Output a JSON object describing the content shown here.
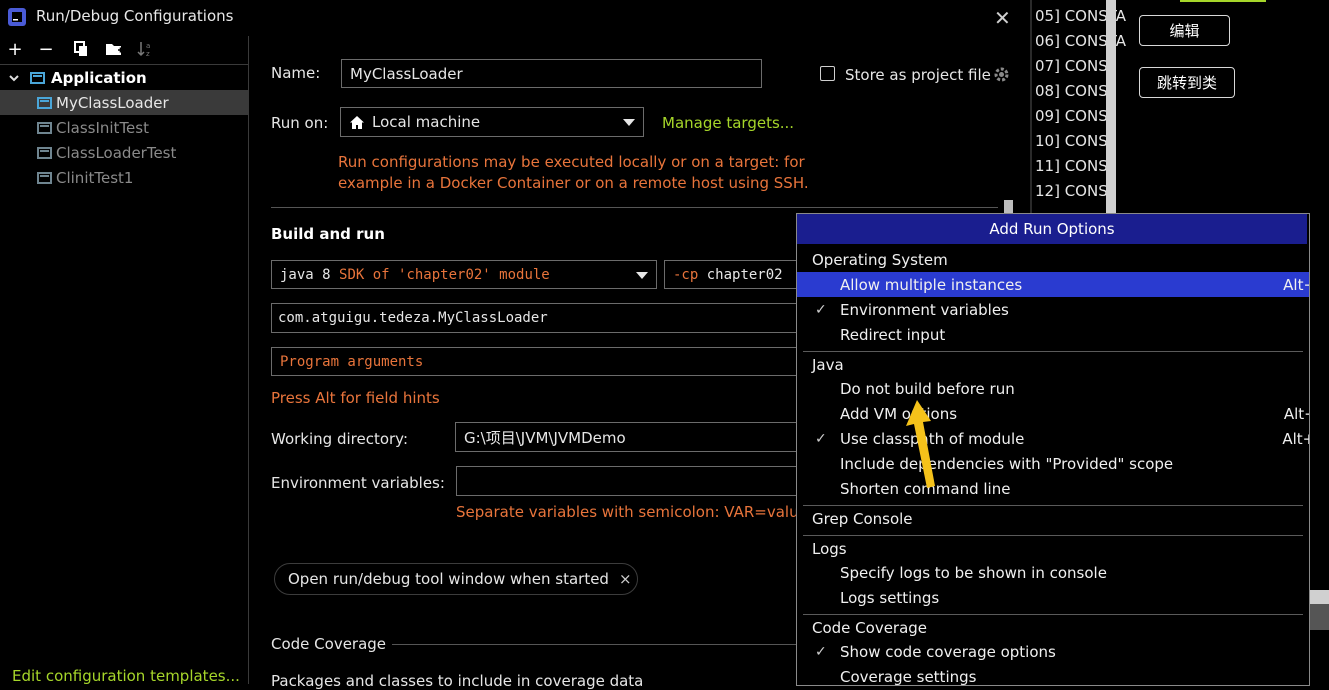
{
  "window": {
    "title": "Run/Debug Configurations",
    "close_icon": "close-icon"
  },
  "toolbar": {
    "add": "+",
    "remove": "−",
    "copy": "copy-icon",
    "new_folder": "new-folder-icon",
    "sort": "sort-icon"
  },
  "tree": {
    "root": "Application",
    "items": [
      {
        "label": "MyClassLoader",
        "selected": true
      },
      {
        "label": "ClassInitTest",
        "selected": false
      },
      {
        "label": "ClassLoaderTest",
        "selected": false
      },
      {
        "label": "ClinitTest1",
        "selected": false
      }
    ],
    "edit_templates": "Edit configuration templates..."
  },
  "form": {
    "name_label": "Name:",
    "name_value": "MyClassLoader",
    "store_label": "Store as project file",
    "run_on_label": "Run on:",
    "run_on_value": "Local machine",
    "manage_targets": "Manage targets...",
    "run_on_hint_1": "Run configurations may be executed locally or on a target: for",
    "run_on_hint_2": "example in a Docker Container or on a remote host using SSH.",
    "build_and_run": "Build and run",
    "sdk_prefix": "java 8",
    "sdk_suffix": "SDK of 'chapter02' module",
    "cp_flag": "-cp",
    "cp_value": "chapter02",
    "main_class": "com.atguigu.tedeza.MyClassLoader",
    "program_args_placeholder": "Program arguments",
    "alt_hint": "Press Alt for field hints",
    "working_dir_label": "Working directory:",
    "working_dir_value": "G:\\项目\\JVM\\JVMDemo",
    "env_label": "Environment variables:",
    "env_value": "",
    "env_hint": "Separate variables with semicolon: VAR=value;",
    "chip_label": "Open run/debug tool window when started",
    "chip_close": "×",
    "code_coverage": "Code Coverage",
    "packages_label": "Packages and classes to include in coverage data"
  },
  "right_strip": {
    "lines": [
      "05] CONSTA",
      "06] CONSTA",
      "07] CONS",
      "08] CONS",
      "09] CONS",
      "10] CONS",
      "11] CONS",
      "12] CONS"
    ],
    "edit_button": "编辑",
    "jump_button": "跳转到类"
  },
  "popup": {
    "title": "Add Run Options",
    "sections": [
      {
        "title": "Operating System",
        "items": [
          {
            "label": "Allow multiple instances",
            "shortcut": "Alt+U",
            "checked": false,
            "highlighted": true
          },
          {
            "label": "Environment variables",
            "shortcut": "",
            "checked": true
          },
          {
            "label": "Redirect input",
            "shortcut": "",
            "checked": false
          }
        ]
      },
      {
        "title": "Java",
        "items": [
          {
            "label": "Do not build before run",
            "shortcut": "",
            "checked": false
          },
          {
            "label": "Add VM options",
            "shortcut": "Alt+V",
            "checked": false
          },
          {
            "label": "Use classpath of module",
            "shortcut": "Alt+O",
            "checked": true
          },
          {
            "label": "Include dependencies with \"Provided\" scope",
            "shortcut": "",
            "checked": false
          },
          {
            "label": "Shorten command line",
            "shortcut": "",
            "checked": false
          }
        ]
      },
      {
        "title": "Grep Console",
        "items": []
      },
      {
        "title": "Logs",
        "items": [
          {
            "label": "Specify logs to be shown in console",
            "shortcut": "",
            "checked": false
          },
          {
            "label": "Logs settings",
            "shortcut": "",
            "checked": false,
            "submenu": true
          }
        ]
      },
      {
        "title": "Code Coverage",
        "items": [
          {
            "label": "Show code coverage options",
            "shortcut": "",
            "checked": true
          },
          {
            "label": "Coverage settings",
            "shortcut": "",
            "checked": false,
            "submenu": true
          }
        ]
      }
    ]
  },
  "colors": {
    "accent_green": "#a6d62a",
    "hint_orange": "#e8743b",
    "popup_header": "#1a1e8f",
    "highlight": "#2a3bd0"
  }
}
